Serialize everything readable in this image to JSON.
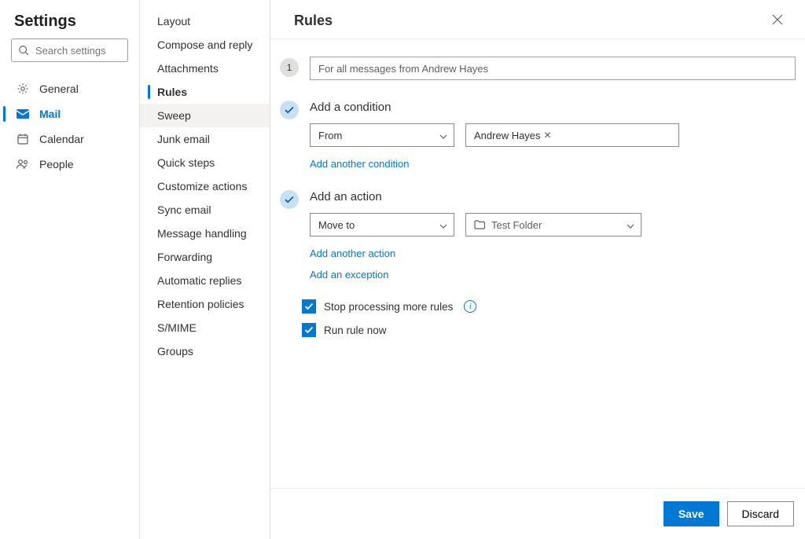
{
  "header": {
    "title": "Settings",
    "search_placeholder": "Search settings"
  },
  "primary_nav": [
    {
      "label": "General",
      "icon": "gear",
      "selected": false
    },
    {
      "label": "Mail",
      "icon": "mail",
      "selected": true
    },
    {
      "label": "Calendar",
      "icon": "calendar",
      "selected": false
    },
    {
      "label": "People",
      "icon": "people",
      "selected": false
    }
  ],
  "secondary_nav": [
    {
      "label": "Layout"
    },
    {
      "label": "Compose and reply"
    },
    {
      "label": "Attachments"
    },
    {
      "label": "Rules",
      "selected": true
    },
    {
      "label": "Sweep",
      "hover": true
    },
    {
      "label": "Junk email"
    },
    {
      "label": "Quick steps"
    },
    {
      "label": "Customize actions"
    },
    {
      "label": "Sync email"
    },
    {
      "label": "Message handling"
    },
    {
      "label": "Forwarding"
    },
    {
      "label": "Automatic replies"
    },
    {
      "label": "Retention policies"
    },
    {
      "label": "S/MIME"
    },
    {
      "label": "Groups"
    }
  ],
  "main": {
    "title": "Rules",
    "step1_number": "1",
    "rule_name": "For all messages from Andrew Hayes",
    "condition": {
      "title": "Add a condition",
      "field_label": "From",
      "chip": "Andrew Hayes",
      "add_more": "Add another condition"
    },
    "action": {
      "title": "Add an action",
      "field_label": "Move to",
      "folder": "Test Folder",
      "add_more": "Add another action",
      "add_exception": "Add an exception"
    },
    "checkboxes": {
      "stop_rules": "Stop processing more rules",
      "run_now": "Run rule now"
    },
    "footer": {
      "save": "Save",
      "discard": "Discard"
    }
  }
}
